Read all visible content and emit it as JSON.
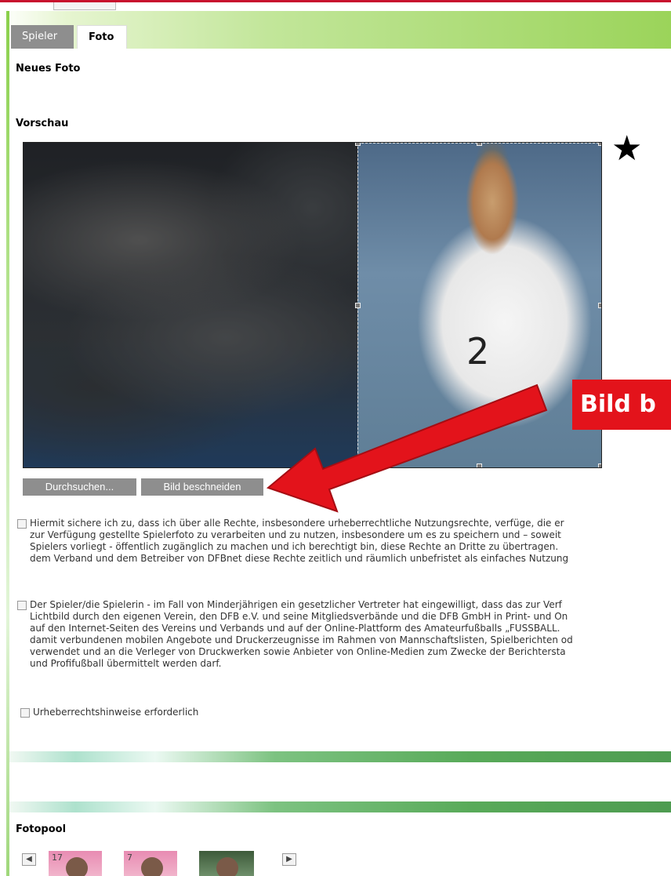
{
  "tabs": [
    {
      "label": "Spieler",
      "active": false
    },
    {
      "label": "Foto",
      "active": true
    }
  ],
  "sections": {
    "new_photo": "Neues Foto",
    "preview": "Vorschau",
    "photo_pool": "Fotopool"
  },
  "preview": {
    "jersey_number": "2"
  },
  "buttons": {
    "browse": "Durchsuchen...",
    "crop": "Bild beschneiden"
  },
  "annotation": {
    "callout": "Bild b",
    "star": "★"
  },
  "consents": [
    {
      "checked": false,
      "lines": [
        "Hiermit sichere ich zu, dass ich über alle Rechte, insbesondere urheberrechtliche Nutzungsrechte, verfüge, die er",
        "zur Verfügung gestellte Spielerfoto zu verarbeiten und zu nutzen, insbesondere um es zu speichern und – soweit",
        "Spielers vorliegt - öffentlich zugänglich zu machen und ich berechtigt bin, diese Rechte an Dritte zu übertragen.",
        "dem Verband und dem Betreiber von DFBnet diese Rechte zeitlich und räumlich unbefristet als einfaches Nutzung"
      ]
    },
    {
      "checked": false,
      "lines": [
        "Der Spieler/die Spielerin - im Fall von Minderjährigen ein gesetzlicher Vertreter hat eingewilligt, dass das zur Verf",
        "Lichtbild durch den eigenen Verein, den DFB e.V. und seine Mitgliedsverbände und die DFB GmbH in Print- und On",
        "auf den Internet-Seiten des Vereins und Verbands und auf der Online-Plattform des Amateurfußballs „FUSSBALL.",
        "damit verbundenen mobilen Angebote und Druckerzeugnisse im Rahmen von Mannschaftslisten, Spielberichten od",
        "verwendet und an die Verleger von Druckwerken sowie Anbieter von Online-Medien zum Zwecke der Berichtersta",
        "und Profifußball übermittelt werden darf."
      ]
    },
    {
      "checked": false,
      "lines": [
        "Urheberrechtshinweise erforderlich"
      ]
    }
  ],
  "pool": {
    "prev": "◀",
    "next": "▶",
    "thumbs": [
      {
        "label": "17"
      },
      {
        "label": "7"
      },
      {
        "label": ""
      }
    ]
  },
  "colors": {
    "accent_red": "#e3131b",
    "tab_grey": "#8e8e8e",
    "brand_green": "#9bd45a"
  }
}
